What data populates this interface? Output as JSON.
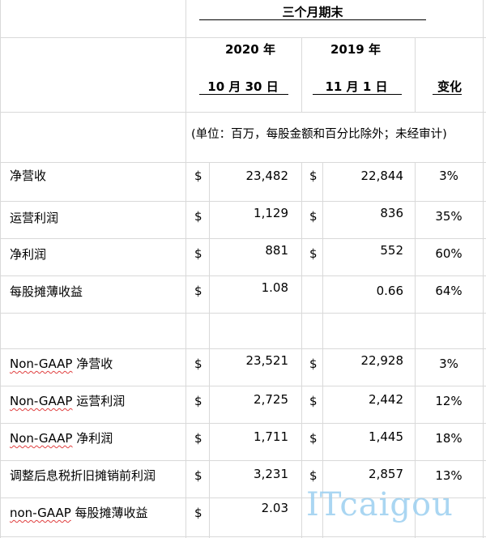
{
  "header": {
    "period": "三个月期末",
    "col1_year": "2020 年",
    "col1_date": "10 月 30 日",
    "col2_year": "2019 年",
    "col2_date": "11 月 1 日",
    "change": "变化"
  },
  "unit_note": "(单位：百万，每股金额和百分比除外；未经审计)",
  "currency": "$",
  "rows": [
    {
      "label": "净营收",
      "v2020": "23,482",
      "v2019": "22,844",
      "change": "3%"
    },
    {
      "label": "运营利润",
      "v2020": "1,129",
      "v2019": "836",
      "change": "35%"
    },
    {
      "label": "净利润",
      "v2020": "881",
      "v2019": "552",
      "change": "60%"
    },
    {
      "label": "每股摊薄收益",
      "v2020": "1.08",
      "v2019": "0.66",
      "change": "64%"
    },
    {
      "label_prefix": "Non-GAAP",
      "label": " 净营收",
      "v2020": "23,521",
      "v2019": "22,928",
      "change": "3%"
    },
    {
      "label_prefix": "Non-GAAP",
      "label": " 运营利润",
      "v2020": "2,725",
      "v2019": "2,442",
      "change": "12%"
    },
    {
      "label_prefix": "Non-GAAP",
      "label": " 净利润",
      "v2020": "1,711",
      "v2019": "1,445",
      "change": "18%"
    },
    {
      "label": "调整后息税折旧摊销前利润",
      "v2020": "3,231",
      "v2019": "2,857",
      "change": "13%"
    },
    {
      "label_prefix": "non-GAAP",
      "label": " 每股摊薄收益",
      "v2020": "2.03"
    }
  ],
  "watermark": "ITcaigou"
}
